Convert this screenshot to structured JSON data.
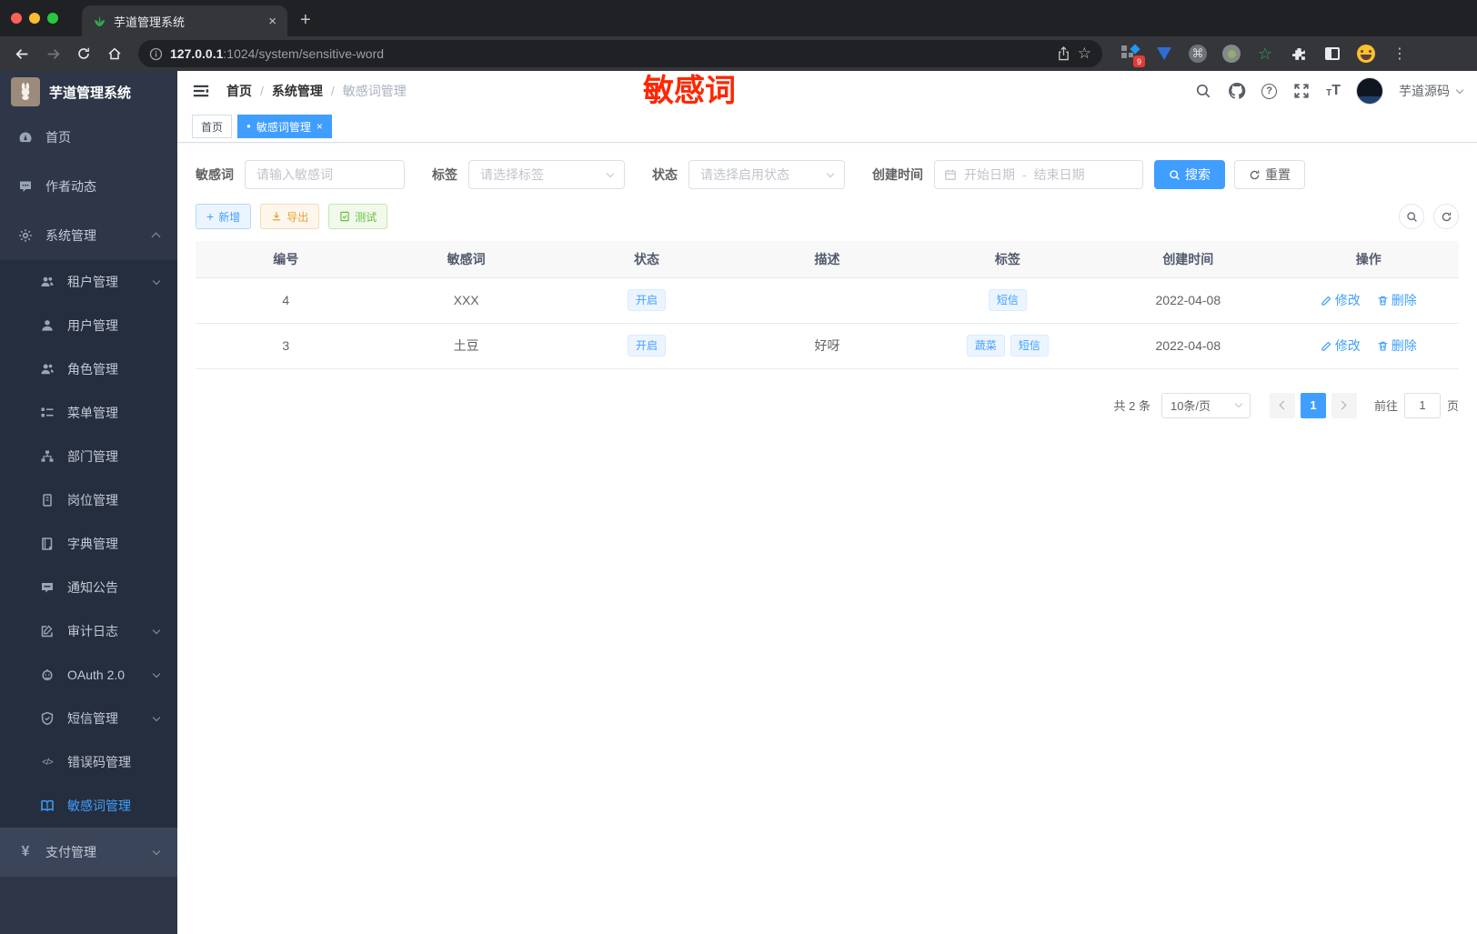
{
  "browser": {
    "tab_title": "芋道管理系统",
    "close_tab": "×",
    "new_tab": "+",
    "url_host": "127.0.0.1",
    "url_rest": ":1024/system/sensitive-word",
    "ext_badge": "9"
  },
  "annotation": {
    "text": "敏感词",
    "color": "#ff2600"
  },
  "sidebar": {
    "title": "芋道管理系统",
    "items": [
      {
        "label": "首页"
      },
      {
        "label": "作者动态"
      },
      {
        "label": "系统管理"
      },
      {
        "label": "租户管理"
      },
      {
        "label": "用户管理"
      },
      {
        "label": "角色管理"
      },
      {
        "label": "菜单管理"
      },
      {
        "label": "部门管理"
      },
      {
        "label": "岗位管理"
      },
      {
        "label": "字典管理"
      },
      {
        "label": "通知公告"
      },
      {
        "label": "审计日志"
      },
      {
        "label": "OAuth 2.0"
      },
      {
        "label": "短信管理"
      },
      {
        "label": "错误码管理"
      },
      {
        "label": "敏感词管理"
      },
      {
        "label": "支付管理"
      }
    ]
  },
  "header": {
    "breadcrumb": [
      "首页",
      "系统管理",
      "敏感词管理"
    ],
    "separator": "/",
    "username": "芋道源码"
  },
  "tabs": {
    "home": "首页",
    "active": "敏感词管理",
    "dot": "●",
    "close": "×"
  },
  "filters": {
    "keyword_label": "敏感词",
    "keyword_placeholder": "请输入敏感词",
    "tag_label": "标签",
    "tag_placeholder": "请选择标签",
    "status_label": "状态",
    "status_placeholder": "请选择启用状态",
    "date_label": "创建时间",
    "date_start": "开始日期",
    "date_separator": "-",
    "date_end": "结束日期",
    "search_label": "搜索",
    "reset_label": "重置"
  },
  "toolbar": {
    "add_label": "新增",
    "export_label": "导出",
    "test_label": "测试"
  },
  "table": {
    "headers": [
      "编号",
      "敏感词",
      "状态",
      "描述",
      "标签",
      "创建时间",
      "操作"
    ],
    "edit_label": "修改",
    "delete_label": "删除",
    "rows": [
      {
        "id": "4",
        "word": "XXX",
        "status": "开启",
        "desc": "",
        "tags": [
          "短信"
        ],
        "created": "2022-04-08"
      },
      {
        "id": "3",
        "word": "土豆",
        "status": "开启",
        "desc": "好呀",
        "tags": [
          "蔬菜",
          "短信"
        ],
        "created": "2022-04-08"
      }
    ]
  },
  "pagination": {
    "total": "共 2 条",
    "page_size": "10条/页",
    "page": "1",
    "goto_label": "前往",
    "goto_value": "1",
    "page_unit": "页"
  },
  "colors": {
    "accent": "#409eff",
    "warning": "#e6a23c",
    "success": "#67c23a",
    "annotation_red": "#ff2600"
  },
  "icons": {
    "question": "?",
    "command": "⌘",
    "star": "☆",
    "menu_dots": "⋮",
    "yen": "¥",
    "code": "</>",
    "plus": "+",
    "font": "T"
  }
}
